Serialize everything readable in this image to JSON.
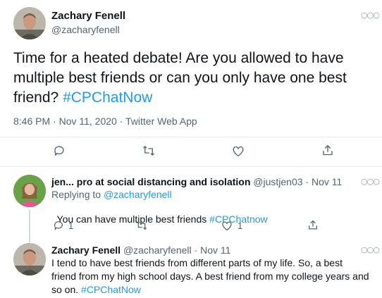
{
  "tweet": {
    "author_name": "Zachary Fenell",
    "author_handle": "@zacharyfenell",
    "text_main": "Time for a heated debate! Are you allowed to have multiple best friends or can you only have one best friend?",
    "hashtag": "#CPChatNow",
    "meta": "8:46 PM · Nov 11, 2020 · Twitter Web App",
    "actions": [
      "reply-icon",
      "retweet-icon",
      "like-icon",
      "share-icon"
    ]
  },
  "reply1": {
    "author_name": "jen... pro at social distancing and isolation",
    "author_handle": "@justjen03",
    "separator": " · ",
    "date": "Nov 11",
    "replying_prefix": "Replying to ",
    "replying_handle": "@zacharyfenell",
    "text_main": "You can have multiple best friends ",
    "hashtag": "#CPChatnow",
    "reply_count": "1",
    "like_count": "1"
  },
  "reply2": {
    "author_name": "Zachary Fenell",
    "author_handle": "@zacharyfenell",
    "separator": " · ",
    "date": "Nov 11",
    "text_line1": "I tend to have best friends from different parts of my life. So, a best",
    "text_line2": "friend from my high school days. A best friend from my college years and",
    "text_line3": "so on. ",
    "hashtag": "#CPChatNow"
  },
  "colors": {
    "link": "#1d9bf0",
    "muted": "#536471",
    "divider": "#e6ecf0"
  }
}
